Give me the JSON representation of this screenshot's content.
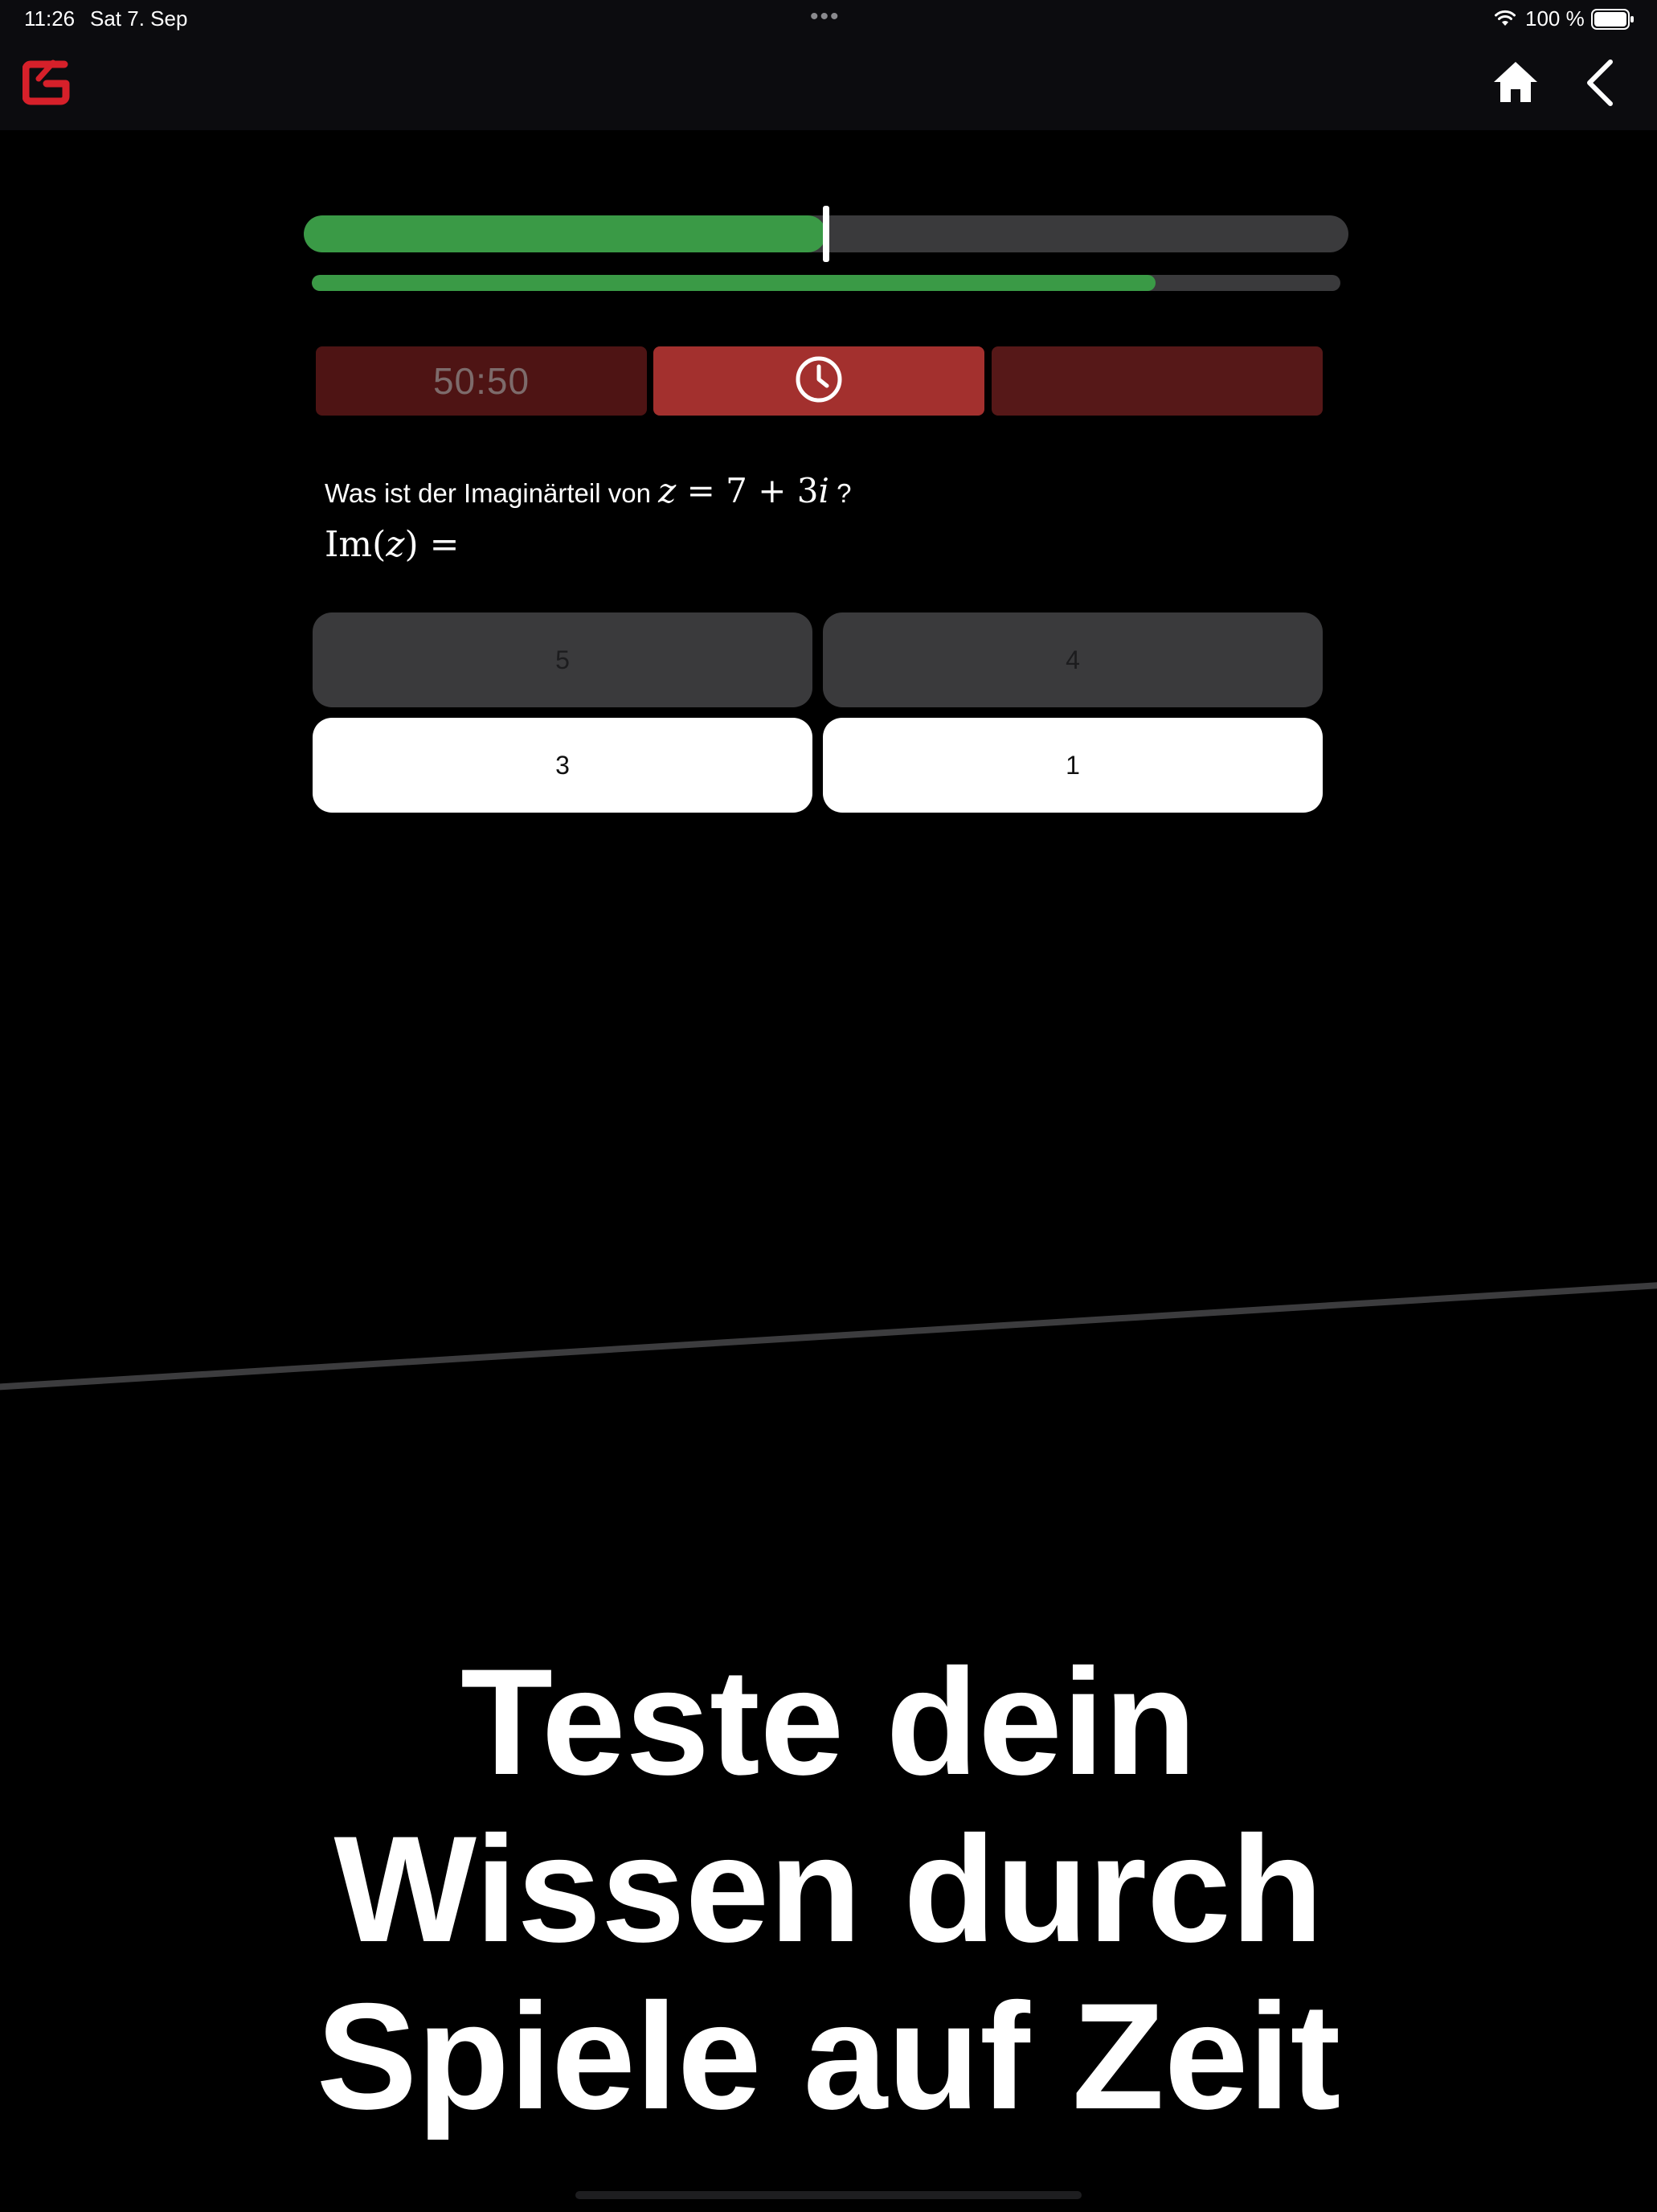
{
  "status_bar": {
    "time": "11:26",
    "date": "Sat 7. Sep",
    "dots": "•••",
    "battery_percent": "100 %",
    "wifi_icon": "wifi-icon",
    "battery_icon": "battery-icon"
  },
  "nav": {
    "logo_icon": "app-logo-icon",
    "home_icon": "home-icon",
    "back_icon": "chevron-left-icon"
  },
  "progress": {
    "top_fraction": 0.5,
    "bottom_fraction": 0.82,
    "accent_color": "#3a9a46"
  },
  "jokers": [
    {
      "label": "50:50",
      "state": "disabled"
    },
    {
      "icon": "clock-icon",
      "state": "active"
    },
    {
      "label": "",
      "state": "disabled"
    }
  ],
  "question": {
    "prefix": "Was ist der Imaginärteil von",
    "math_z": "z",
    "math_eq": " = 7 + 3",
    "math_i": "i",
    "suffix": "?",
    "formula_im": "Im(",
    "formula_z": "z",
    "formula_close": ") ="
  },
  "answers": [
    {
      "label": "5",
      "state": "disabled"
    },
    {
      "label": "4",
      "state": "disabled"
    },
    {
      "label": "3",
      "state": "enabled"
    },
    {
      "label": "1",
      "state": "enabled"
    }
  ],
  "promo": {
    "line1": "Teste dein",
    "line2": "Wissen durch",
    "line3": "Spiele auf Zeit"
  }
}
